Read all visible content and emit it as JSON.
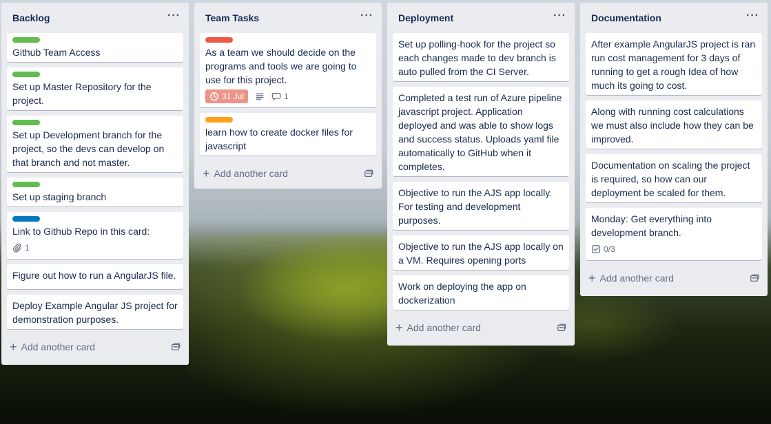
{
  "colors": {
    "green": "#61bd4f",
    "red": "#eb5a46",
    "orange": "#ff9f1a",
    "blue": "#0079bf",
    "due_bg": "#ec9488"
  },
  "lists": [
    {
      "title": "Backlog",
      "menu": "···",
      "add_label": "Add another card",
      "cards": [
        {
          "label_color": "green",
          "text": "Github Team Access"
        },
        {
          "label_color": "green",
          "text": "Set up Master Repository for the project."
        },
        {
          "label_color": "green",
          "text": "Set up Development branch for the project, so the devs can develop on that branch and not master."
        },
        {
          "label_color": "green",
          "text": "Set up staging branch"
        },
        {
          "label_color": "blue",
          "text": "Link to Github Repo in this card:",
          "attachments": "1"
        },
        {
          "text": "Figure out how to run a AngularJS file."
        },
        {
          "text": "Deploy Example Angular JS project for demonstration purposes."
        }
      ]
    },
    {
      "title": "Team Tasks",
      "menu": "···",
      "add_label": "Add another card",
      "cards": [
        {
          "label_color": "red",
          "text": "As a team we should decide on the programs and tools we are going to use for this project.",
          "due": "31 Jul",
          "has_description": true,
          "comments": "1"
        },
        {
          "label_color": "orange",
          "text": "learn how to create docker files for javascript"
        }
      ]
    },
    {
      "title": "Deployment",
      "menu": "···",
      "add_label": "Add another card",
      "cards": [
        {
          "text": "Set up polling-hook for the project so each changes made to dev branch is auto pulled from the CI Server."
        },
        {
          "text": "Completed a test run of Azure pipeline javascript project. Application deployed and was able to show logs and success status. Uploads yaml file automatically to GitHub when it completes."
        },
        {
          "text": "Objective to run the AJS app locally. For testing and development purposes."
        },
        {
          "text": "Objective to run the AJS app locally on a VM. Requires opening ports"
        },
        {
          "text": "Work on deploying the app on dockerization"
        }
      ]
    },
    {
      "title": "Documentation",
      "menu": "···",
      "add_label": "Add another card",
      "cards": [
        {
          "text": "After example AngularJS project is ran run cost management for 3 days of running to get a rough Idea of how much its going to cost."
        },
        {
          "text": "Along with running cost calculations we must also include how they can be improved."
        },
        {
          "text": "Documentation on scaling the project is required, so how can our deployment be scaled for them."
        },
        {
          "text": "Monday: Get everything into development branch.",
          "checklist": "0/3"
        }
      ]
    }
  ]
}
